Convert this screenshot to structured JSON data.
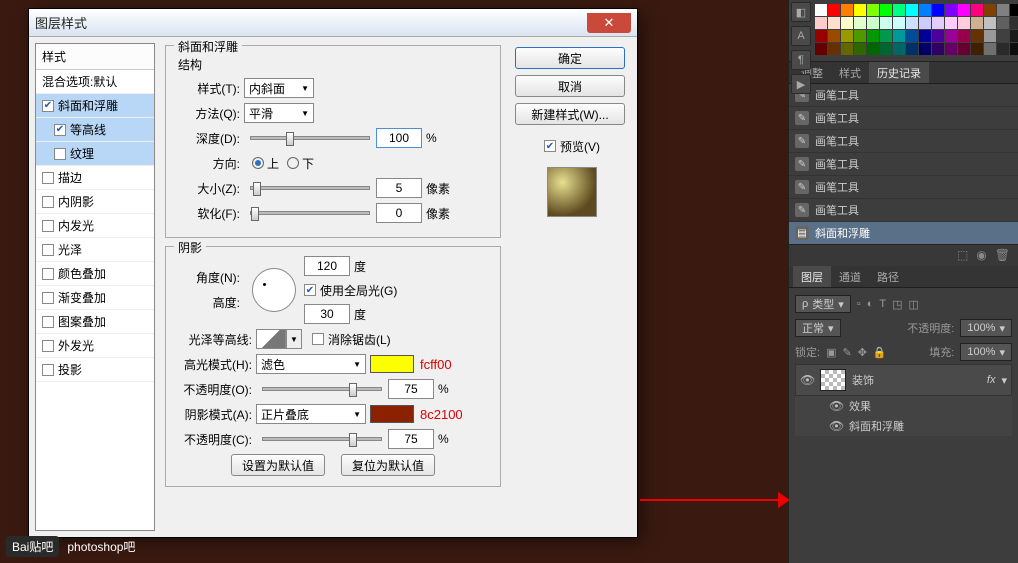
{
  "dialog": {
    "title": "图层样式",
    "styles_header": "样式",
    "blend_options": "混合选项:默认",
    "items": [
      {
        "label": "斜面和浮雕",
        "checked": true,
        "selected": true,
        "indent": false
      },
      {
        "label": "等高线",
        "checked": true,
        "selected": true,
        "indent": true
      },
      {
        "label": "纹理",
        "checked": false,
        "selected": true,
        "indent": true
      },
      {
        "label": "描边",
        "checked": false,
        "selected": false,
        "indent": false
      },
      {
        "label": "内阴影",
        "checked": false,
        "selected": false,
        "indent": false
      },
      {
        "label": "内发光",
        "checked": false,
        "selected": false,
        "indent": false
      },
      {
        "label": "光泽",
        "checked": false,
        "selected": false,
        "indent": false
      },
      {
        "label": "颜色叠加",
        "checked": false,
        "selected": false,
        "indent": false
      },
      {
        "label": "渐变叠加",
        "checked": false,
        "selected": false,
        "indent": false
      },
      {
        "label": "图案叠加",
        "checked": false,
        "selected": false,
        "indent": false
      },
      {
        "label": "外发光",
        "checked": false,
        "selected": false,
        "indent": false
      },
      {
        "label": "投影",
        "checked": false,
        "selected": false,
        "indent": false
      }
    ],
    "buttons": {
      "ok": "确定",
      "cancel": "取消",
      "new_style": "新建样式(W)...",
      "preview": "预览(V)",
      "set_default": "设置为默认值",
      "reset_default": "复位为默认值"
    }
  },
  "bevel": {
    "section_title": "斜面和浮雕",
    "structure_title": "结构",
    "style_label": "样式(T):",
    "style_value": "内斜面",
    "technique_label": "方法(Q):",
    "technique_value": "平滑",
    "depth_label": "深度(D):",
    "depth_value": "100",
    "depth_unit": "%",
    "direction_label": "方向:",
    "dir_up": "上",
    "dir_down": "下",
    "size_label": "大小(Z):",
    "size_value": "5",
    "size_unit": "像素",
    "soften_label": "软化(F):",
    "soften_value": "0",
    "soften_unit": "像素",
    "shading_title": "阴影",
    "angle_label": "角度(N):",
    "angle_value": "120",
    "angle_unit": "度",
    "global_light": "使用全局光(G)",
    "altitude_label": "高度:",
    "altitude_value": "30",
    "altitude_unit": "度",
    "gloss_label": "光泽等高线:",
    "antialias": "消除锯齿(L)",
    "hl_mode_label": "高光模式(H):",
    "hl_mode_value": "滤色",
    "hl_color": "#fcff00",
    "hl_hex": "fcff00",
    "hl_opacity_label": "不透明度(O):",
    "hl_opacity_value": "75",
    "hl_opacity_unit": "%",
    "sh_mode_label": "阴影模式(A):",
    "sh_mode_value": "正片叠底",
    "sh_color": "#8c2100",
    "sh_hex": "8c2100",
    "sh_opacity_label": "不透明度(C):",
    "sh_opacity_value": "75",
    "sh_opacity_unit": "%"
  },
  "panels": {
    "tabs_adjust": "调整",
    "tabs_styles": "样式",
    "tabs_history": "历史记录",
    "history_items": [
      "画笔工具",
      "画笔工具",
      "画笔工具",
      "画笔工具",
      "画笔工具",
      "画笔工具"
    ],
    "history_selected": "斜面和浮雕",
    "layer_tabs": {
      "layers": "图层",
      "channels": "通道",
      "paths": "路径"
    },
    "kind_label": "类型",
    "blend_mode": "正常",
    "opacity_label": "不透明度:",
    "opacity_value": "100%",
    "lock_label": "锁定:",
    "fill_label": "填充:",
    "fill_value": "100%",
    "layer_name": "装饰",
    "fx": "fx",
    "sub_effects": "效果",
    "sub_bevel": "斜面和浮雕"
  },
  "swatch_colors": [
    "#ffffff",
    "#ff0000",
    "#ff8000",
    "#ffff00",
    "#80ff00",
    "#00ff00",
    "#00ff80",
    "#00ffff",
    "#0080ff",
    "#0000ff",
    "#8000ff",
    "#ff00ff",
    "#ff0080",
    "#804000",
    "#808080",
    "#000000",
    "#ffcccc",
    "#ffe0cc",
    "#ffffcc",
    "#e0ffcc",
    "#ccffcc",
    "#ccffee",
    "#ccffff",
    "#cce0ff",
    "#ccccff",
    "#e0ccff",
    "#ffccff",
    "#ffcce0",
    "#d0b090",
    "#c0c0c0",
    "#606060",
    "#303030",
    "#990000",
    "#994c00",
    "#999900",
    "#4c9900",
    "#009900",
    "#00994c",
    "#009999",
    "#004c99",
    "#000099",
    "#4c0099",
    "#990099",
    "#99004c",
    "#663300",
    "#999999",
    "#404040",
    "#1a1a1a",
    "#660000",
    "#663000",
    "#666600",
    "#306600",
    "#006600",
    "#006630",
    "#006666",
    "#003066",
    "#000066",
    "#300066",
    "#660066",
    "#660030",
    "#402000",
    "#707070",
    "#2a2a2a",
    "#0d0d0d"
  ],
  "watermark": {
    "brand": "Bai贴吧",
    "board": "photoshop吧"
  }
}
